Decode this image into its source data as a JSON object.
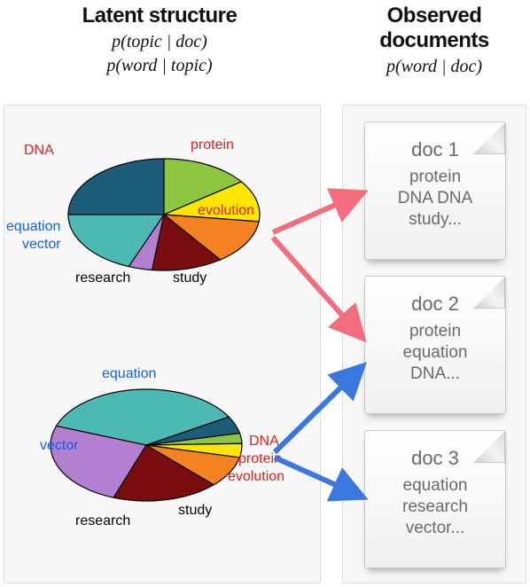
{
  "headers": {
    "left_title": "Latent structure",
    "left_sub1": "p(topic | doc)",
    "left_sub2": "p(word | topic)",
    "right_title_line1": "Observed",
    "right_title_line2": "documents",
    "right_sub": "p(word | doc)"
  },
  "pies": {
    "top": {
      "labels": {
        "dna": "DNA",
        "protein": "protein",
        "evolution": "evolution",
        "equation": "equation",
        "vector": "vector",
        "research": "research",
        "study": "study"
      },
      "slices": [
        {
          "name": "DNA",
          "color": "#1d5d7a",
          "value": 25
        },
        {
          "name": "protein",
          "color": "#8cc63f",
          "value": 15
        },
        {
          "name": "evolution",
          "color": "#ffe600",
          "value": 12
        },
        {
          "name": "study",
          "color": "#f58220",
          "value": 13
        },
        {
          "name": "research",
          "color": "#7a0e0e",
          "value": 12
        },
        {
          "name": "vector",
          "color": "#b37fd1",
          "value": 4
        },
        {
          "name": "equation",
          "color": "#4db9b5",
          "value": 19
        }
      ]
    },
    "bottom": {
      "labels": {
        "equation": "equation",
        "vector": "vector",
        "dna": "DNA",
        "protein": "protein",
        "evolution": "evolution",
        "research": "research",
        "study": "study"
      },
      "slices": [
        {
          "name": "equation",
          "color": "#4db9b5",
          "value": 36
        },
        {
          "name": "DNA",
          "color": "#1d5d7a",
          "value": 5
        },
        {
          "name": "protein",
          "color": "#8cc63f",
          "value": 3
        },
        {
          "name": "evolution",
          "color": "#ffe600",
          "value": 4
        },
        {
          "name": "study",
          "color": "#f58220",
          "value": 9
        },
        {
          "name": "research",
          "color": "#7a0e0e",
          "value": 18
        },
        {
          "name": "vector",
          "color": "#b37fd1",
          "value": 25
        }
      ]
    }
  },
  "docs": {
    "d1": {
      "title": "doc 1",
      "line1": "protein",
      "line2": "DNA DNA",
      "line3": "study..."
    },
    "d2": {
      "title": "doc 2",
      "line1": "protein",
      "line2": "equation",
      "line3": "DNA..."
    },
    "d3": {
      "title": "doc 3",
      "line1": "equation",
      "line2": "research",
      "line3": "vector..."
    }
  },
  "arrows": {
    "top_color": "#f26d7d",
    "bottom_color": "#3a78e0"
  },
  "chart_data": [
    {
      "type": "pie",
      "title": "Topic 1 word distribution (biology-weighted)",
      "series": [
        {
          "name": "DNA",
          "value": 25,
          "color": "#1d5d7a"
        },
        {
          "name": "protein",
          "value": 15,
          "color": "#8cc63f"
        },
        {
          "name": "evolution",
          "value": 12,
          "color": "#ffe600"
        },
        {
          "name": "study",
          "value": 13,
          "color": "#f58220"
        },
        {
          "name": "research",
          "value": 12,
          "color": "#7a0e0e"
        },
        {
          "name": "vector",
          "value": 4,
          "color": "#b37fd1"
        },
        {
          "name": "equation",
          "value": 19,
          "color": "#4db9b5"
        }
      ],
      "label_groups": {
        "red": [
          "DNA",
          "protein",
          "evolution"
        ],
        "blue": [
          "equation",
          "vector"
        ],
        "black": [
          "research",
          "study"
        ]
      }
    },
    {
      "type": "pie",
      "title": "Topic 2 word distribution (math-weighted)",
      "series": [
        {
          "name": "equation",
          "value": 36,
          "color": "#4db9b5"
        },
        {
          "name": "DNA",
          "value": 5,
          "color": "#1d5d7a"
        },
        {
          "name": "protein",
          "value": 3,
          "color": "#8cc63f"
        },
        {
          "name": "evolution",
          "value": 4,
          "color": "#ffe600"
        },
        {
          "name": "study",
          "value": 9,
          "color": "#f58220"
        },
        {
          "name": "research",
          "value": 18,
          "color": "#7a0e0e"
        },
        {
          "name": "vector",
          "value": 25,
          "color": "#b37fd1"
        }
      ],
      "label_groups": {
        "red": [
          "DNA",
          "protein",
          "evolution"
        ],
        "blue": [
          "equation",
          "vector"
        ],
        "black": [
          "research",
          "study"
        ]
      }
    }
  ]
}
